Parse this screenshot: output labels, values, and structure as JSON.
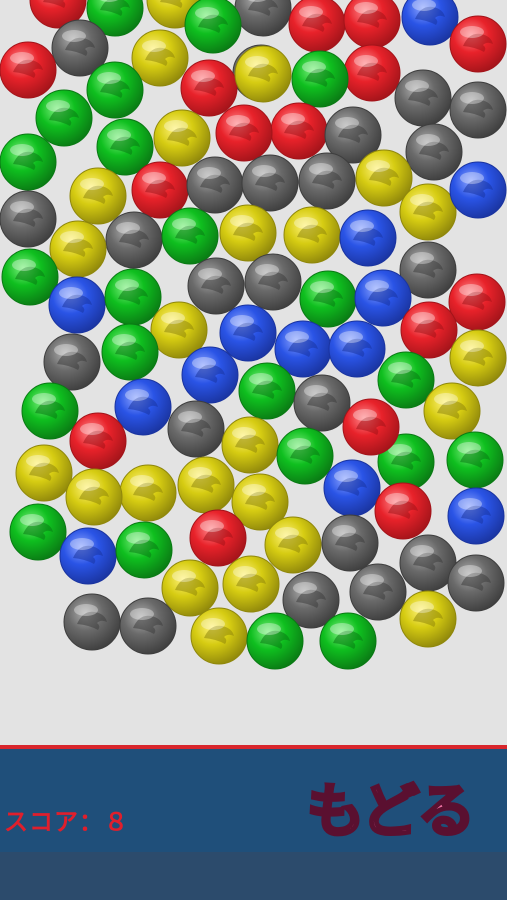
{
  "game": {
    "score_text": "スコア：８",
    "back_label": "もどる"
  },
  "colors": {
    "background": "#e3e3e3",
    "bar": "#1f4f7a",
    "bar_lower": "#2c4b6c",
    "bar_accent_line": "#d8262c",
    "score_text": "#e01f2c",
    "back_text": "#f175a6"
  },
  "ball_palette": {
    "red": {
      "base": "#e8222a",
      "light": "#ff8a8e",
      "dark": "#a3141a"
    },
    "green": {
      "base": "#0fbf1f",
      "light": "#7ef07f",
      "dark": "#0a7a14"
    },
    "blue": {
      "base": "#2a54e6",
      "light": "#8ea6ff",
      "dark": "#1a34a0"
    },
    "yellow": {
      "base": "#d6cc12",
      "light": "#fff27a",
      "dark": "#8f870b"
    },
    "gray": {
      "base": "#6a6a6a",
      "light": "#b0b0b0",
      "dark": "#3e3e3e"
    }
  },
  "balls": [
    "red",
    "green",
    "yellow",
    "gray",
    "gray",
    "red",
    "yellow",
    "green",
    "red",
    "red",
    "blue",
    "red",
    "red",
    "gray",
    "red",
    "green",
    "yellow",
    "green",
    "gray",
    "gray",
    "green",
    "yellow",
    "green",
    "red",
    "red",
    "gray",
    "gray",
    "green",
    "yellow",
    "yellow",
    "red",
    "gray",
    "gray",
    "gray",
    "gray",
    "yellow",
    "blue",
    "gray",
    "yellow",
    "green",
    "yellow",
    "yellow",
    "blue",
    "gray",
    "green",
    "blue",
    "green",
    "gray",
    "gray",
    "green",
    "blue",
    "red",
    "yellow",
    "blue",
    "red",
    "blue",
    "blue",
    "yellow",
    "gray",
    "green",
    "blue",
    "green",
    "green",
    "gray",
    "yellow",
    "green",
    "blue",
    "gray",
    "red",
    "yellow",
    "green",
    "green",
    "green",
    "red",
    "yellow",
    "yellow",
    "yellow",
    "yellow",
    "yellow",
    "blue",
    "red",
    "blue",
    "green",
    "blue",
    "green",
    "red",
    "yellow",
    "gray",
    "gray",
    "gray",
    "yellow",
    "yellow",
    "gray",
    "gray",
    "yellow",
    "gray",
    "gray",
    "yellow",
    "green",
    "green",
    "gray",
    "blue"
  ]
}
